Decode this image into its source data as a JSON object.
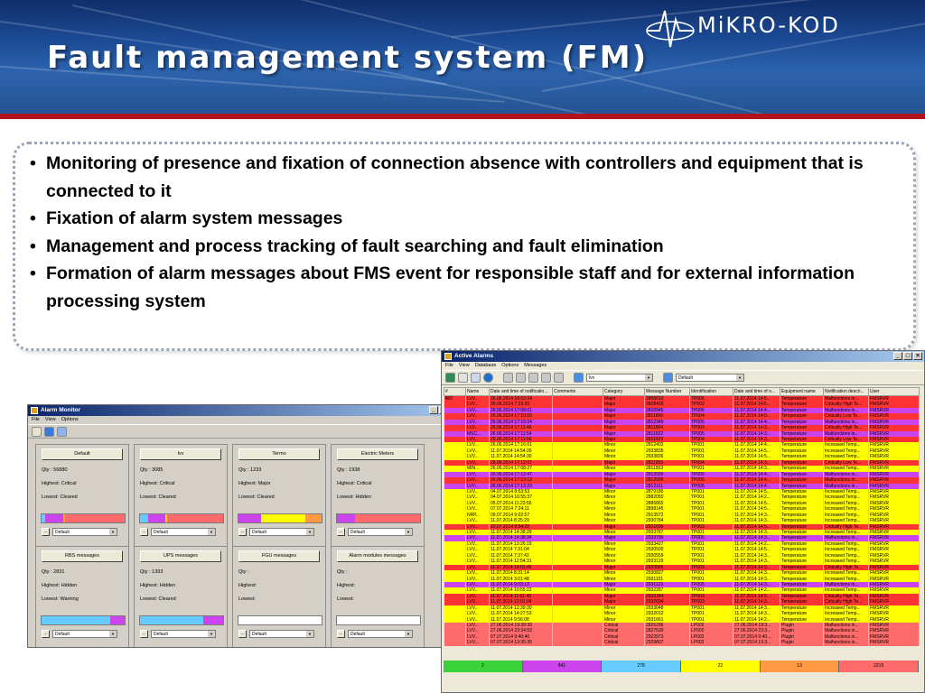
{
  "title": "Fault management system (FM)",
  "logo": {
    "text": "MiKRO-KOD",
    "icon": "mikro-kod-logo-icon"
  },
  "colors": {
    "banner": "#1d4c96",
    "banner_bar": "#b3141c",
    "major": "#ff3333",
    "minor": "#ffff00",
    "cleared": "#3bd23b",
    "info": "#66ccff",
    "warning": "#cc44ee",
    "critical": "#ff6b6b",
    "plugin": "#ff6b6b"
  },
  "bullets": [
    "Monitoring of presence and fixation of connection absence with controllers and equipment that is connected to it",
    "Fixation of alarm system messages",
    "Management and process tracking of fault searching and fault elimination",
    "Formation of alarm messages about FMS event for responsible staff and for external information processing system"
  ],
  "alarm_monitor": {
    "window_title": "Alarm Monitor",
    "menu": [
      "File",
      "View",
      "Options"
    ],
    "panels": [
      {
        "name": "Default",
        "qty": "Qty : 56880",
        "highest": "Highest: Critical",
        "lowest": "Lowest: Cleared",
        "select": "Default",
        "bar": [
          "#66ccff:4",
          "#cc44ee:22",
          "#ff9944:2",
          "#ff6b6b:72"
        ]
      },
      {
        "name": "lvv",
        "qty": "Qty : 3085",
        "highest": "Highest: Critical",
        "lowest": "Lowest: Cleared",
        "select": "Default",
        "bar": [
          "#66ccff:10",
          "#cc44ee:20",
          "#ffd700:3",
          "#ff6b6b:67"
        ]
      },
      {
        "name": "Termo",
        "qty": "Qty : 1233",
        "highest": "Highest: Major",
        "lowest": "Lowest: Cleared",
        "select": "Default",
        "bar": [
          "#cc44ee:27",
          "#ffff00:53",
          "#ff9944:20"
        ]
      },
      {
        "name": "Electric Meters",
        "qty": "Qty : 1938",
        "highest": "Highest: Critical",
        "lowest": "Lowest: Hidden",
        "select": "Default",
        "bar": [
          "#cc44ee:22",
          "#ff6b6b:78"
        ]
      },
      {
        "name": "RBS messages",
        "qty": "Qty : 2831",
        "highest": "Highest: Hidden",
        "lowest": "Lowest: Warning",
        "select": "Default",
        "bar": [
          "#66ccff:83",
          "#cc44ee:17"
        ]
      },
      {
        "name": "UPS messages",
        "qty": "Qty : 1393",
        "highest": "Highest: Hidden",
        "lowest": "Lowest: Cleared",
        "select": "Default",
        "bar": [
          "#66ccff:76",
          "#cc44ee:24"
        ]
      },
      {
        "name": "FGU messages",
        "qty": "Qty :",
        "highest": "Highest:",
        "lowest": "Lowest:",
        "select": "Default",
        "bar": []
      },
      {
        "name": "Alarm modules messages",
        "qty": "Qty :",
        "highest": "Highest:",
        "lowest": "Lowest:",
        "select": "Default",
        "bar": []
      }
    ]
  },
  "active_alarms": {
    "window_title": "Active Alarms",
    "menu": [
      "File",
      "View",
      "Database",
      "Options",
      "Messages"
    ],
    "toolbar_select_1": "lvv",
    "toolbar_select_2": "Default",
    "columns": [
      "#",
      "Name",
      "Date and time of notificatio...",
      "Comments",
      "Category",
      "Message Number",
      "Identification",
      "Date and time of o...",
      "Equipment name",
      "Notification descri...",
      "User"
    ],
    "rows": [
      [
        "483",
        "LVV...",
        "26.06.2014 16:53:24",
        "",
        "Major",
        "2809610",
        "TP005",
        "11.07.2014 14:5...",
        "Temperature",
        "Malfunctions in...",
        "FMSRVR",
        "major"
      ],
      [
        "",
        "LVV...",
        "26.06.2014 7:23:20",
        "",
        "Major",
        "2828426",
        "TP003",
        "11.07.2014 14:5...",
        "Temperature",
        "Critically High Te...",
        "FMSRVR",
        "major"
      ],
      [
        "",
        "LVV...",
        "26.06.2014 17:08:01",
        "",
        "Major",
        "2810945",
        "TP006",
        "11.07.2014 14:4...",
        "Temperature",
        "Malfunctions in...",
        "FMSRVR",
        "warning"
      ],
      [
        "",
        "LVV...",
        "26.06.2014 17:10:50",
        "",
        "Major",
        "2811660",
        "TP004",
        "11.07.2014 14:0...",
        "Temperature",
        "Critically Low Te...",
        "FMSRVR",
        "major"
      ],
      [
        "",
        "LVV...",
        "26.06.2014 17:15:04",
        "",
        "Major",
        "2812346",
        "TP005",
        "11.07.2014 14:4...",
        "Temperature",
        "Malfunctions in...",
        "FMSRVR",
        "warning"
      ],
      [
        "",
        "LVV...",
        "26.06.2014 17:11:46",
        "",
        "Major",
        "2811904",
        "TP003",
        "11.07.2014 14:3...",
        "Temperature",
        "Critically High Te...",
        "FMSRVR",
        "major"
      ],
      [
        "",
        "MSC...",
        "26.06.2014 17:11:54",
        "",
        "Major",
        "2811922",
        "TP005",
        "11.07.2014 14:3...",
        "Temperature",
        "Malfunctions in...",
        "FMSRVR",
        "warning"
      ],
      [
        "",
        "LVV...",
        "26.06.2014 17:11:56",
        "",
        "Major",
        "2811929",
        "TP004",
        "11.07.2014 14:3...",
        "Temperature",
        "Critically Low Te...",
        "FMSRVR",
        "major"
      ],
      [
        "",
        "LVV...",
        "26.06.2014 17:16:01",
        "",
        "Minor",
        "2812403",
        "TP001",
        "11.07.2014 14:4...",
        "Temperature",
        "Increased Temp...",
        "FMSRVR",
        "minor"
      ],
      [
        "",
        "LVV...",
        "11.07.2014 14:54:26",
        "",
        "Minor",
        "2933835",
        "TP001",
        "11.07.2014 14:5...",
        "Temperature",
        "Increased Temp...",
        "FMSRVR",
        "minor"
      ],
      [
        "",
        "LVV...",
        "11.07.2014 14:54:30",
        "",
        "Minor",
        "2933836",
        "TP001",
        "11.07.2014 14:5...",
        "Temperature",
        "Increased Temp...",
        "FMSRVR",
        "minor"
      ],
      [
        "",
        "LVV...",
        "26.06.2014 17:12:07",
        "",
        "Major",
        "2811955",
        "TP004",
        "11.07.2014 14:3...",
        "Temperature",
        "Critically Low Te...",
        "FMSRVR",
        "major"
      ],
      [
        "",
        "MIN...",
        "26.06.2014 17:08:27",
        "",
        "Minor",
        "2811503",
        "TP001",
        "11.07.2014 14:3...",
        "Temperature",
        "Increased Temp...",
        "FMSRVR",
        "minor"
      ],
      [
        "",
        "LVV...",
        "26.06.2014 17:12:47",
        "",
        "Major",
        "2812026",
        "TP005",
        "11.07.2014 14:4...",
        "Temperature",
        "Malfunctions in...",
        "FMSRVR",
        "warning"
      ],
      [
        "",
        "LVV...",
        "26.06.2014 17:13:13",
        "",
        "Major",
        "2812095",
        "TP005",
        "11.07.2014 14:4...",
        "Temperature",
        "Malfunctions in...",
        "FMSRVR",
        "major"
      ],
      [
        "",
        "LVV...",
        "26.06.2014 17:13:23",
        "",
        "Major",
        "2812111",
        "TP005",
        "11.07.2014 14:4...",
        "Temperature",
        "Malfunctions in...",
        "FMSRVR",
        "warning"
      ],
      [
        "",
        "LVV...",
        "04.07.2014 8:53:53",
        "",
        "Minor",
        "2879180",
        "TP001",
        "11.07.2014 14:5...",
        "Temperature",
        "Increased Temp...",
        "FMSRVR",
        "minor"
      ],
      [
        "",
        "LVV...",
        "04.07.2014 16:55:37",
        "",
        "Minor",
        "2882050",
        "TP001",
        "11.07.2014 14:2...",
        "Temperature",
        "Increased Temp...",
        "FMSRVR",
        "minor"
      ],
      [
        "",
        "LVV...",
        "05.07.2014 11:23:55",
        "",
        "Minor",
        "2886865",
        "TP001",
        "11.07.2014 14:5...",
        "Temperature",
        "Increased Temp...",
        "FMSRVR",
        "minor"
      ],
      [
        "",
        "LVV...",
        "07.07.2014 7:24:11",
        "",
        "Minor",
        "2898145",
        "TP001",
        "11.07.2014 14:5...",
        "Temperature",
        "Increased Temp...",
        "FMSRVR",
        "minor"
      ],
      [
        "",
        "NRP...",
        "09.07.2014 9:02:57",
        "",
        "Minor",
        "2913572",
        "TP001",
        "11.07.2014 14:3...",
        "Temperature",
        "Increased Temp...",
        "FMSRVR",
        "minor"
      ],
      [
        "",
        "LVV...",
        "11.07.2014 8:25:29",
        "",
        "Minor",
        "2930784",
        "TP001",
        "11.07.2014 14:3...",
        "Temperature",
        "Increased Temp...",
        "FMSRVR",
        "minor"
      ],
      [
        "",
        "LVV...",
        "10.07.2014 8:54:25",
        "",
        "Major",
        "2921699",
        "TP003",
        "11.07.2014 14:5...",
        "Temperature",
        "Critically High Te...",
        "FMSRVR",
        "major"
      ],
      [
        "",
        "LVV...",
        "11.07.2014 14:38:29",
        "",
        "Minor",
        "2933787",
        "TP001",
        "11.07.2014 14:3...",
        "Temperature",
        "Increased Temp...",
        "FMSRVR",
        "minor"
      ],
      [
        "",
        "LVV...",
        "11.07.2014 14:38:34",
        "",
        "Major",
        "2933790",
        "TP005",
        "11.07.2014 14:3...",
        "Temperature",
        "Malfunctions in...",
        "FMSRVR",
        "warning"
      ],
      [
        "",
        "LVV...",
        "11.07.2014 13:26:19",
        "",
        "Minor",
        "2933427",
        "TP001",
        "11.07.2014 14:2...",
        "Temperature",
        "Increased Temp...",
        "FMSRVR",
        "minor"
      ],
      [
        "",
        "LVV...",
        "11.07.2014 7:31:04",
        "",
        "Minor",
        "2930500",
        "TP001",
        "11.07.2014 14:5...",
        "Temperature",
        "Increased Temp...",
        "FMSRVR",
        "minor"
      ],
      [
        "",
        "LVV...",
        "11.07.2014 7:37:42",
        "",
        "Minor",
        "2930559",
        "TP001",
        "11.07.2014 14:3...",
        "Temperature",
        "Increased Temp...",
        "FMSRVR",
        "minor"
      ],
      [
        "",
        "LVV...",
        "11.07.2014 12:54:31",
        "",
        "Minor",
        "2933129",
        "TP001",
        "11.07.2014 14:3...",
        "Temperature",
        "Increased Temp...",
        "FMSRVR",
        "minor"
      ],
      [
        "",
        "LVV...",
        "11.07.2014 14:01:45",
        "",
        "Major",
        "2933585",
        "TP003",
        "11.07.2014 14:3...",
        "Temperature",
        "Critically High Te...",
        "FMSRVR",
        "major"
      ],
      [
        "",
        "LVV...",
        "11.07.2014 8:31:14",
        "",
        "Minor",
        "2930827",
        "TP001",
        "11.07.2014 14:3...",
        "Temperature",
        "Increased Temp...",
        "FMSRVR",
        "minor"
      ],
      [
        "",
        "LVV...",
        "11.07.2014 3:01:48",
        "",
        "Minor",
        "2931101",
        "TP001",
        "11.07.2014 14:3...",
        "Temperature",
        "Increased Temp...",
        "FMSRVR",
        "minor"
      ],
      [
        "",
        "LVV...",
        "11.07.2014 9:03:13",
        "",
        "Major",
        "2931123",
        "TP005",
        "11.07.2014 14:3...",
        "Temperature",
        "Malfunctions in...",
        "FMSRVR",
        "warning"
      ],
      [
        "",
        "LVV...",
        "11.07.2014 10:55:22",
        "",
        "Minor",
        "2932287",
        "TP001",
        "11.07.2014 14:2...",
        "Temperature",
        "Increased Temp...",
        "FMSRVR",
        "minor"
      ],
      [
        "",
        "LVV...",
        "11.07.2014 11:01:45",
        "",
        "Major",
        "2932344",
        "TP003",
        "11.07.2014 14:5...",
        "Temperature",
        "Critically High Te...",
        "FMSRVR",
        "major"
      ],
      [
        "",
        "LVV...",
        "11.07.2014 12:01:04",
        "",
        "Major",
        "2932694",
        "TP003",
        "11.07.2014 14:3...",
        "Temperature",
        "Critically High Te...",
        "FMSRVR",
        "major"
      ],
      [
        "",
        "LVV...",
        "11.07.2014 12:39:30",
        "",
        "Minor",
        "2933048",
        "TP001",
        "11.07.2014 14:3...",
        "Temperature",
        "Increased Temp...",
        "FMSRVR",
        "minor"
      ],
      [
        "",
        "LVV...",
        "11.07.2014 14:27:53",
        "",
        "Minor",
        "2932012",
        "TP001",
        "11.07.2014 14:3...",
        "Temperature",
        "Increased Temp...",
        "FMSRVR",
        "minor"
      ],
      [
        "",
        "LVV...",
        "11.07.2014 9:56:08",
        "",
        "Minor",
        "2931661",
        "TP001",
        "11.07.2014 14:2...",
        "Temperature",
        "Increased Temp...",
        "FMSRVR",
        "minor"
      ],
      [
        "",
        "LVV...",
        "27.06.2014 19:39:39",
        "",
        "Critical",
        "2826296",
        "LP002",
        "27.06.2014 19:3...",
        "Plugin",
        "Malfunctions in...",
        "FMSRVR",
        "critical"
      ],
      [
        "",
        "LVV...",
        "27.06.2014 23:34:53",
        "",
        "Critical",
        "2827530",
        "LP002",
        "27.06.2014 23:3...",
        "Plugin",
        "Malfunctions in...",
        "FMSRVR",
        "critical"
      ],
      [
        "",
        "LVV...",
        "07.07.2014 9:40:40",
        "",
        "Critical",
        "2922973",
        "LP002",
        "07.07.2014 9:40...",
        "Plugin",
        "Malfunctions in...",
        "FMSRVR",
        "critical"
      ],
      [
        "",
        "LVV...",
        "07.07.2014 13:35:35",
        "",
        "Critical",
        "2929807",
        "LP002",
        "07.07.2014 13:3...",
        "Plugin",
        "Malfunctions in...",
        "FMSRVR",
        "critical"
      ]
    ],
    "status_counts": [
      {
        "value": "2",
        "color": "#3bd23b"
      },
      {
        "value": "841",
        "color": "#cc44ee"
      },
      {
        "value": "278",
        "color": "#66ccff"
      },
      {
        "value": "22",
        "color": "#ffff00"
      },
      {
        "value": "13",
        "color": "#ff9944"
      },
      {
        "value": "2215",
        "color": "#ff6b6b"
      }
    ]
  }
}
